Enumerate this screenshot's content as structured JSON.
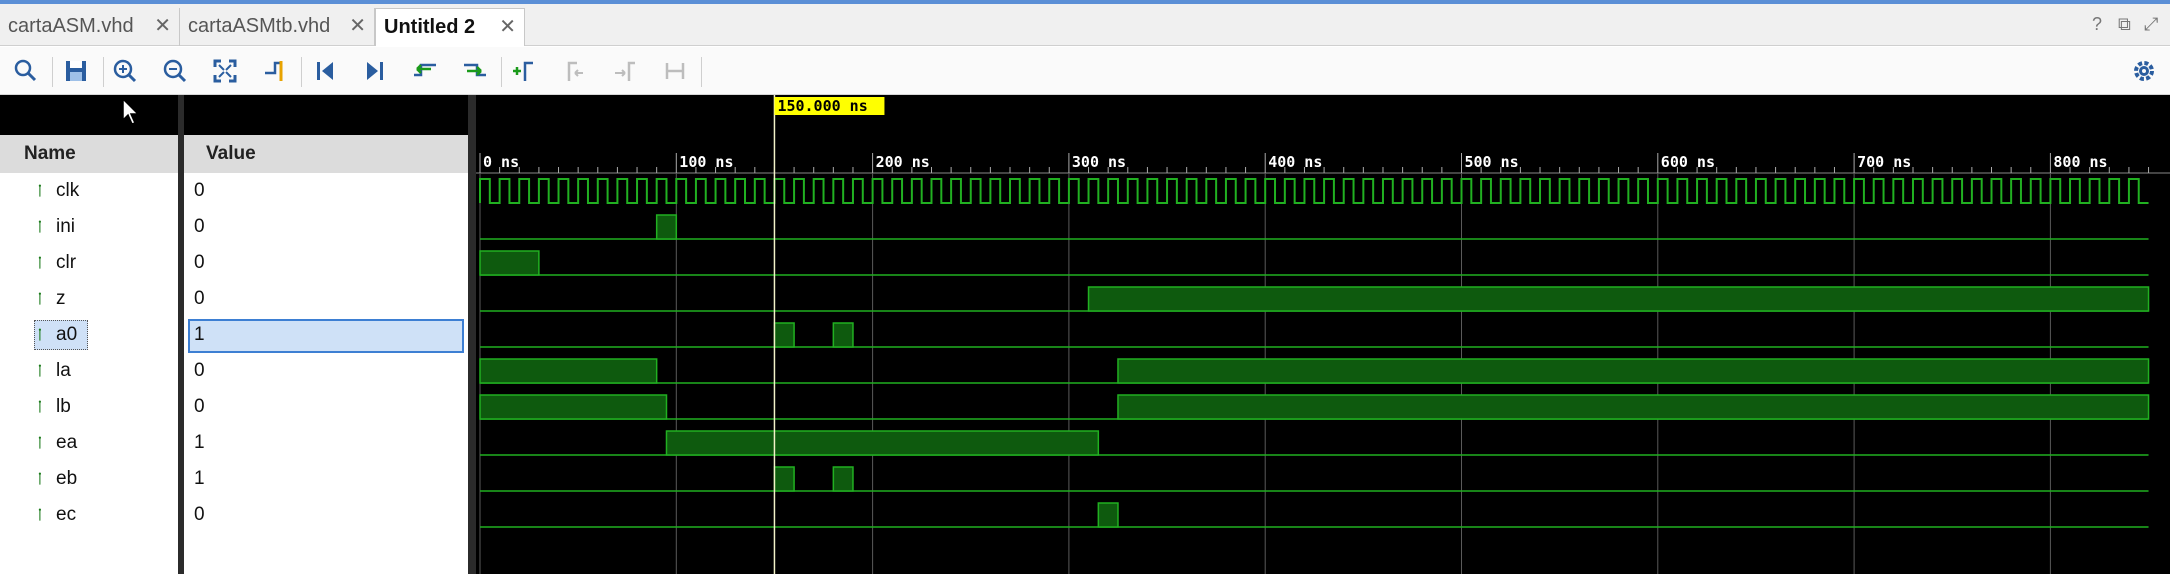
{
  "tabs": [
    {
      "label": "cartaASM.vhd",
      "active": false
    },
    {
      "label": "cartaASMtb.vhd",
      "active": false
    },
    {
      "label": "Untitled 2",
      "active": true
    }
  ],
  "toolbar": {
    "icons": [
      "search-icon",
      "save-icon",
      "zoom-in-icon",
      "zoom-out-icon",
      "zoom-fit-icon",
      "go-to-cursor-icon",
      "go-to-time-zero-icon",
      "go-to-last-time-icon",
      "previous-transition-icon",
      "next-transition-icon",
      "add-marker-icon",
      "previous-marker-icon",
      "next-marker-icon",
      "swap-cursors-icon",
      "settings-gear-icon"
    ]
  },
  "columns": {
    "name": "Name",
    "value": "Value"
  },
  "cursor": {
    "time_label": "150.000 ns",
    "time_ns": 150
  },
  "timeline": {
    "ticks": [
      "0 ns",
      "100 ns",
      "200 ns",
      "300 ns",
      "400 ns",
      "500 ns",
      "600 ns",
      "700 ns",
      "800 ns"
    ],
    "range_ns": [
      0,
      850
    ],
    "clock_period_ns": 10
  },
  "signals": [
    {
      "name": "clk",
      "value": "0",
      "type": "clock",
      "selected": false
    },
    {
      "name": "ini",
      "value": "0",
      "type": "bit",
      "selected": false,
      "high": [
        [
          90,
          100
        ]
      ]
    },
    {
      "name": "clr",
      "value": "0",
      "type": "bit",
      "selected": false,
      "high": [
        [
          0,
          30
        ]
      ]
    },
    {
      "name": "z",
      "value": "0",
      "type": "bit",
      "selected": false,
      "high": [
        [
          310,
          850
        ]
      ]
    },
    {
      "name": "a0",
      "value": "1",
      "type": "bit",
      "selected": true,
      "high": [
        [
          150,
          160
        ],
        [
          180,
          190
        ]
      ]
    },
    {
      "name": "la",
      "value": "0",
      "type": "bit",
      "selected": false,
      "high": [
        [
          0,
          90
        ],
        [
          325,
          850
        ]
      ]
    },
    {
      "name": "lb",
      "value": "0",
      "type": "bit",
      "selected": false,
      "high": [
        [
          0,
          95
        ],
        [
          325,
          850
        ]
      ]
    },
    {
      "name": "ea",
      "value": "1",
      "type": "bit",
      "selected": false,
      "high": [
        [
          95,
          315
        ]
      ]
    },
    {
      "name": "eb",
      "value": "1",
      "type": "bit",
      "selected": false,
      "high": [
        [
          150,
          160
        ],
        [
          180,
          190
        ]
      ]
    },
    {
      "name": "ec",
      "value": "0",
      "type": "bit",
      "selected": false,
      "high": [
        [
          315,
          325
        ]
      ]
    }
  ],
  "colors": {
    "wave": "#21b021",
    "wave_fill": "#0e5a0e",
    "cursor_label_bg": "#ffff00",
    "background": "#000000"
  }
}
